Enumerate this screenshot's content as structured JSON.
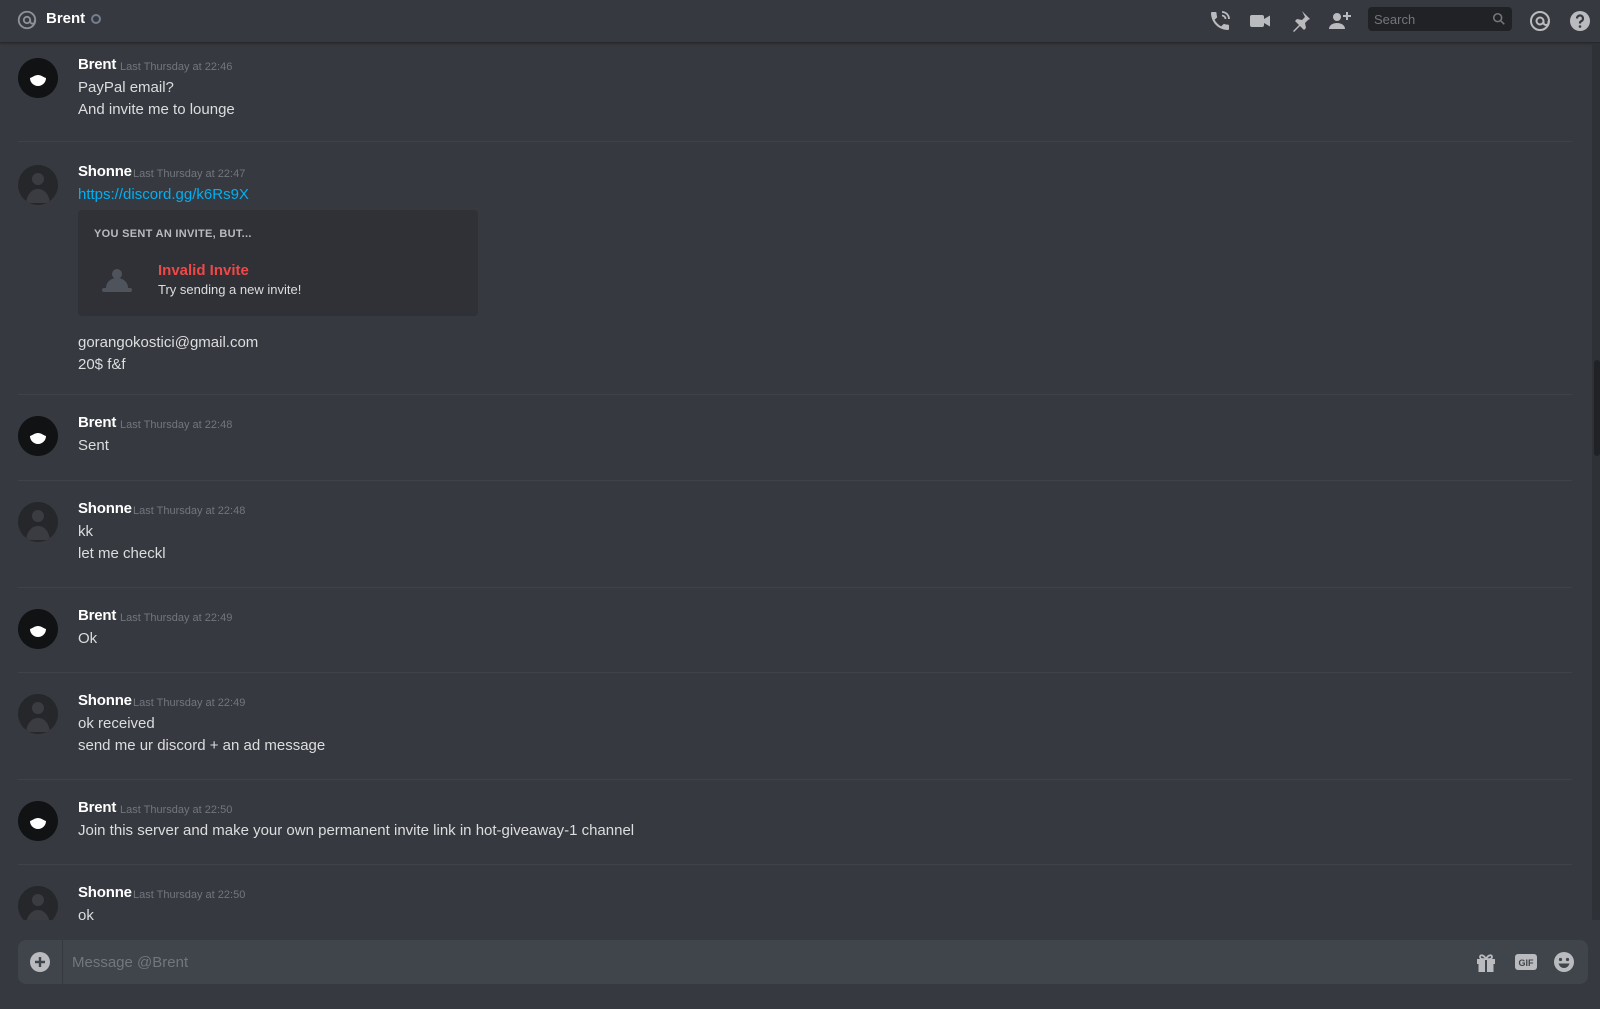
{
  "header": {
    "title": "Brent",
    "search_placeholder": "Search",
    "icons": [
      "at-icon",
      "phone-call-icon",
      "video-call-icon",
      "pin-icon",
      "add-friend-icon",
      "search-icon",
      "mentions-icon",
      "help-icon"
    ]
  },
  "messages": [
    {
      "author": "Brent",
      "timestamp": "Last Thursday at 22:46",
      "lines": [
        "PayPal email?",
        "And invite me to lounge"
      ]
    },
    {
      "author": "Shonne",
      "timestamp": "Last Thursday at 22:47",
      "link": "https://discord.gg/k6Rs9X",
      "embed": {
        "header": "YOU SENT AN INVITE, BUT...",
        "title": "Invalid Invite",
        "subtitle": "Try sending a new invite!"
      },
      "lines": [
        "gorangokostici@gmail.com",
        "20$ f&f"
      ]
    },
    {
      "author": "Brent",
      "timestamp": "Last Thursday at 22:48",
      "lines": [
        "Sent"
      ]
    },
    {
      "author": "Shonne",
      "timestamp": "Last Thursday at 22:48",
      "lines": [
        "kk",
        "let me checkl"
      ]
    },
    {
      "author": "Brent",
      "timestamp": "Last Thursday at 22:49",
      "lines": [
        "Ok"
      ]
    },
    {
      "author": "Shonne",
      "timestamp": "Last Thursday at 22:49",
      "lines": [
        "ok received",
        "send me ur discord + an ad message"
      ]
    },
    {
      "author": "Brent",
      "timestamp": "Last Thursday at 22:50",
      "lines": [
        "Join this server and make your own permanent invite link in hot-giveaway-1 channel"
      ]
    },
    {
      "author": "Shonne",
      "timestamp": "Last Thursday at 22:50",
      "lines": [
        "ok"
      ]
    }
  ],
  "composer": {
    "placeholder": "Message @Brent",
    "icons": [
      "upload-plus-icon",
      "gift-icon",
      "gif-icon",
      "emoji-icon"
    ]
  },
  "colors": {
    "background": "#36393f",
    "link": "#00b0f4",
    "invalid_invite": "#f04747",
    "composer": "#40444b"
  }
}
